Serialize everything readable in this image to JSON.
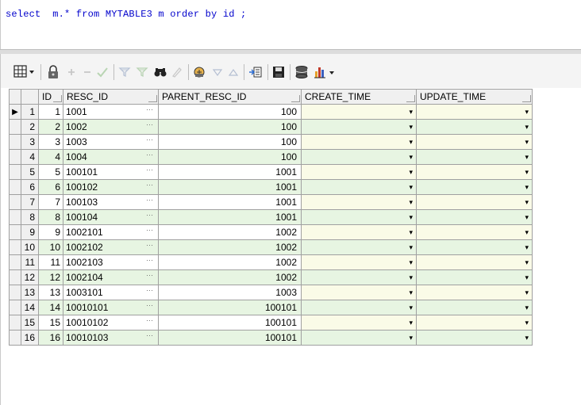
{
  "editor": {
    "sql": "select  m.* from MYTABLE3 m order by id ;"
  },
  "toolbar": {
    "icons": [
      "grid-options-icon",
      "lock-icon",
      "add-record-icon",
      "delete-record-icon",
      "post-changes-icon",
      "query-by-example-icon",
      "clear-filter-icon",
      "find-icon",
      "clear-icon",
      "single-record-view-icon",
      "previous-record-icon",
      "next-record-icon",
      "export-icon",
      "save-icon",
      "connect-icon",
      "chart-icon"
    ]
  },
  "grid": {
    "columns": [
      "ID",
      "RESC_ID",
      "PARENT_RESC_ID",
      "CREATE_TIME",
      "UPDATE_TIME"
    ],
    "ellipsis": "···",
    "dropdown": "▾",
    "current_row_marker": "▶",
    "rows": [
      {
        "n": "1",
        "id": "1",
        "resc_id": "1001",
        "parent": "100"
      },
      {
        "n": "2",
        "id": "2",
        "resc_id": "1002",
        "parent": "100"
      },
      {
        "n": "3",
        "id": "3",
        "resc_id": "1003",
        "parent": "100"
      },
      {
        "n": "4",
        "id": "4",
        "resc_id": "1004",
        "parent": "100"
      },
      {
        "n": "5",
        "id": "5",
        "resc_id": "100101",
        "parent": "1001"
      },
      {
        "n": "6",
        "id": "6",
        "resc_id": "100102",
        "parent": "1001"
      },
      {
        "n": "7",
        "id": "7",
        "resc_id": "100103",
        "parent": "1001"
      },
      {
        "n": "8",
        "id": "8",
        "resc_id": "100104",
        "parent": "1001"
      },
      {
        "n": "9",
        "id": "9",
        "resc_id": "1002101",
        "parent": "1002"
      },
      {
        "n": "10",
        "id": "10",
        "resc_id": "1002102",
        "parent": "1002"
      },
      {
        "n": "11",
        "id": "11",
        "resc_id": "1002103",
        "parent": "1002"
      },
      {
        "n": "12",
        "id": "12",
        "resc_id": "1002104",
        "parent": "1002"
      },
      {
        "n": "13",
        "id": "13",
        "resc_id": "1003101",
        "parent": "1003"
      },
      {
        "n": "14",
        "id": "14",
        "resc_id": "10010101",
        "parent": "100101"
      },
      {
        "n": "15",
        "id": "15",
        "resc_id": "10010102",
        "parent": "100101"
      },
      {
        "n": "16",
        "id": "16",
        "resc_id": "10010103",
        "parent": "100101"
      }
    ]
  }
}
